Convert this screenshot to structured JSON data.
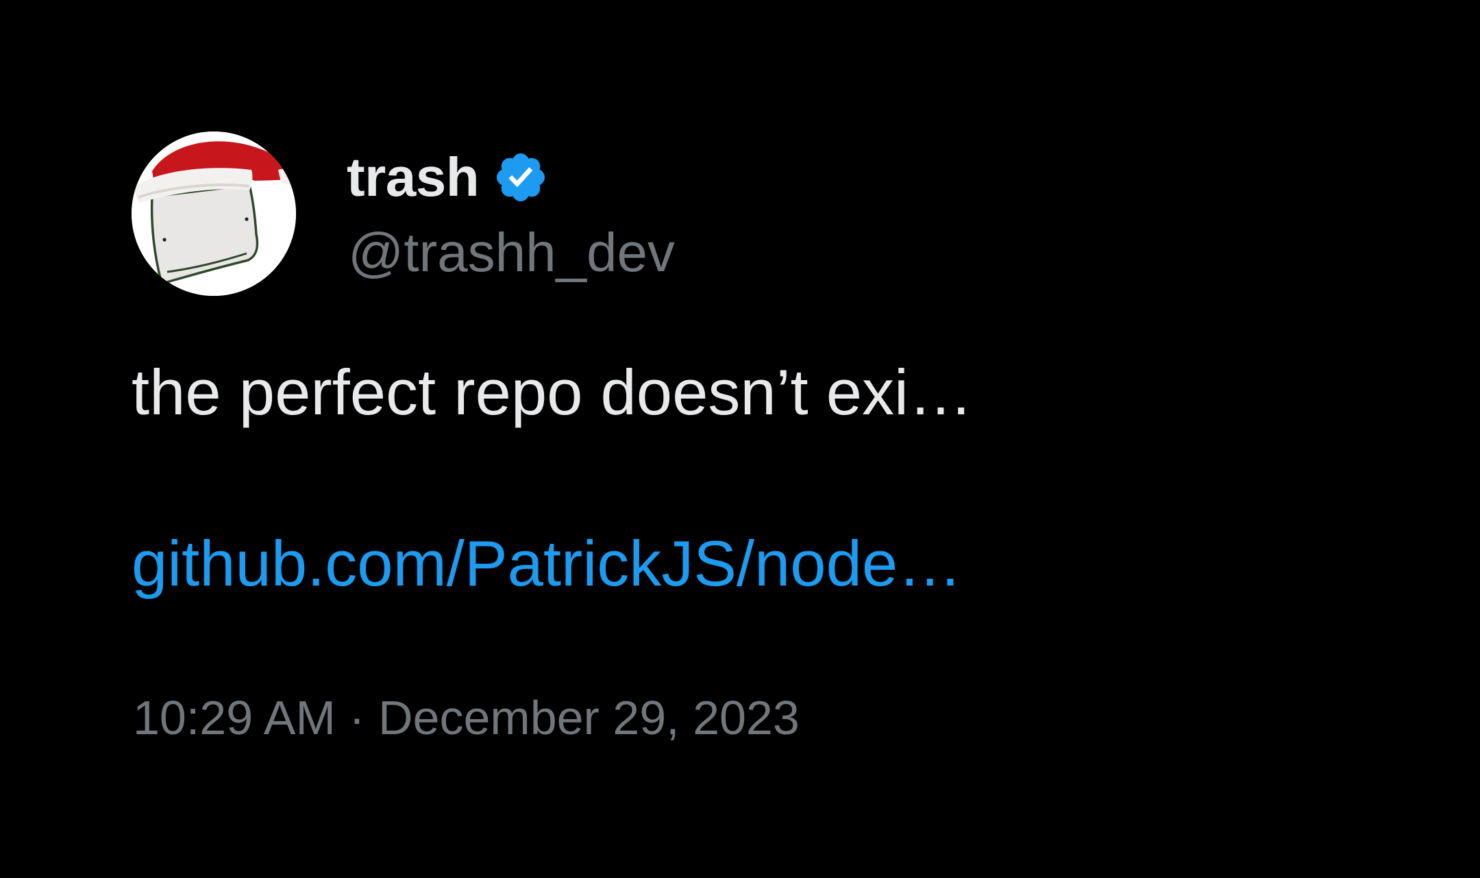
{
  "tweet": {
    "display_name": "trash",
    "handle": "@trashh_dev",
    "verified_icon": "verified-badge-icon",
    "text": "the perfect repo doesn’t exi…",
    "link_text": "github.com/PatrickJS/node…",
    "timestamp": "10:29 AM · December 29, 2023"
  },
  "colors": {
    "background": "#000000",
    "primary_text": "#e7e9ea",
    "secondary_text": "#71767b",
    "link": "#1d9bf0",
    "verified": "#1d9bf0",
    "hat_red": "#c8161d"
  }
}
